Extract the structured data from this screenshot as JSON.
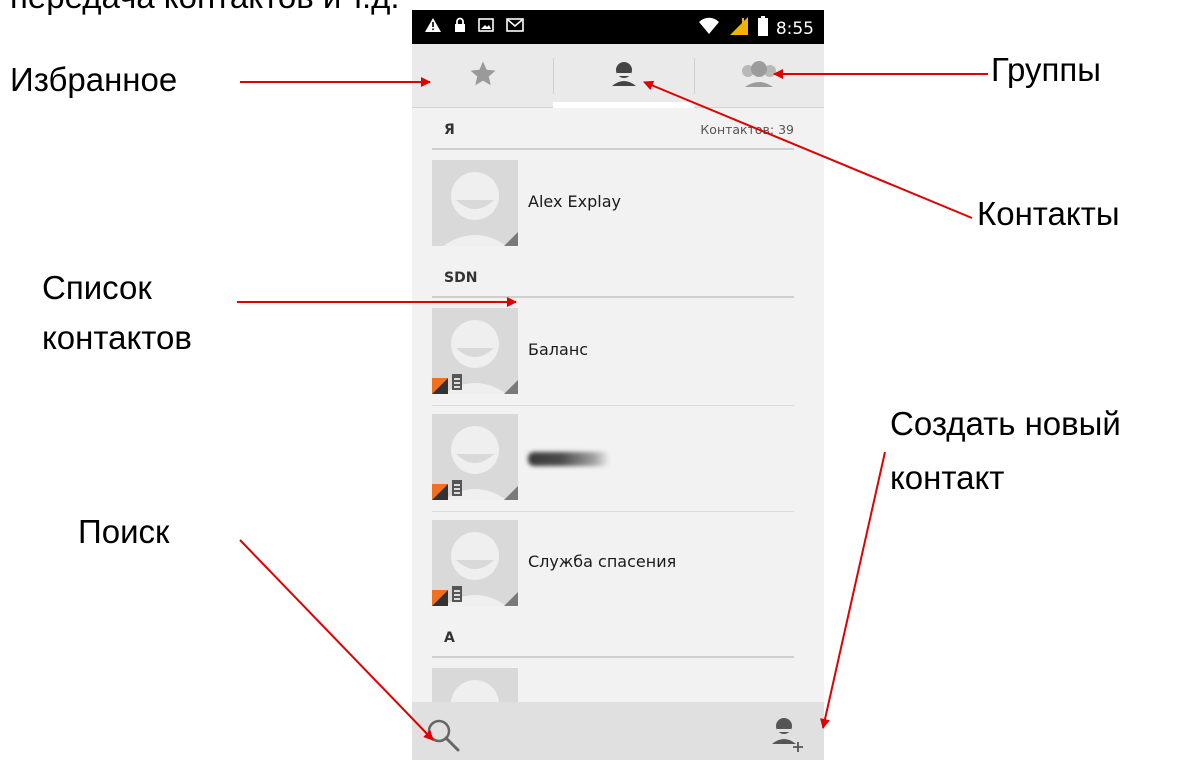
{
  "page_heading_partial": "передача контактов и т.д.",
  "status_bar": {
    "time": "8:55",
    "icons": [
      "warning-icon",
      "lock-icon",
      "image-icon",
      "gmail-icon",
      "wifi-icon",
      "signal-icon",
      "battery-icon"
    ]
  },
  "tabs": [
    {
      "id": "favorites",
      "icon": "star-icon"
    },
    {
      "id": "contacts",
      "icon": "person-icon",
      "selected": true
    },
    {
      "id": "groups",
      "icon": "group-icon"
    }
  ],
  "contacts_list": {
    "count_label": "Контактов: 39",
    "sections": [
      {
        "letter": "Я",
        "contacts": [
          {
            "name": "Alex Explay",
            "sim": false
          }
        ]
      },
      {
        "letter": "SDN",
        "contacts": [
          {
            "name": "Баланс",
            "sim": true
          },
          {
            "name": "",
            "sim": true,
            "blurred": true
          },
          {
            "name": "Служба спасения",
            "sim": true
          }
        ]
      },
      {
        "letter": "A",
        "contacts": [
          {
            "name": "",
            "sim": false
          }
        ]
      }
    ]
  },
  "bottom_bar": {
    "left_icon": "search-icon",
    "right_icon": "add-contact-icon"
  },
  "annotations": {
    "favorites": "Избранное",
    "groups": "Группы",
    "contacts": "Контакты",
    "contact_list_line1": "Список",
    "contact_list_line2": "контактов",
    "create_line1": "Создать новый",
    "create_line2": "контакт",
    "search": "Поиск"
  },
  "colors": {
    "arrow": "#e00000",
    "status_bar": "#000000",
    "tabbar": "#eaeaea",
    "list_bg": "#f2f2f2",
    "sim_badge": "#f07020"
  }
}
